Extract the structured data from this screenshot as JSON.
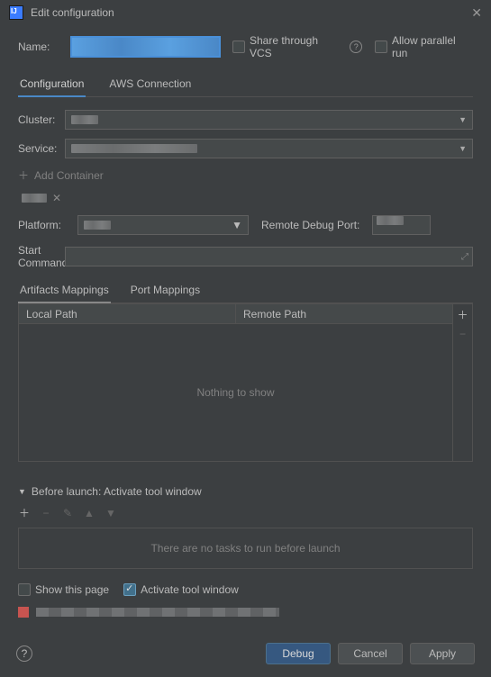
{
  "window": {
    "title": "Edit configuration"
  },
  "name": {
    "label": "Name:",
    "value": ""
  },
  "share_vcs": {
    "label": "Share through VCS",
    "checked": false
  },
  "allow_parallel": {
    "label": "Allow parallel run",
    "checked": false
  },
  "tabs": {
    "config": "Configuration",
    "aws": "AWS Connection"
  },
  "cluster": {
    "label": "Cluster:",
    "value": ""
  },
  "service": {
    "label": "Service:",
    "value": ""
  },
  "add_container": "Add Container",
  "container_tab": {
    "label": ""
  },
  "platform": {
    "label": "Platform:",
    "value": ""
  },
  "remote_port": {
    "label": "Remote Debug Port:",
    "value": ""
  },
  "start_cmd": {
    "label": "Start Command:",
    "value": ""
  },
  "subtabs": {
    "artifacts": "Artifacts Mappings",
    "ports": "Port Mappings"
  },
  "table": {
    "local": "Local Path",
    "remote": "Remote Path",
    "empty": "Nothing to show"
  },
  "before_launch": {
    "header": "Before launch: Activate tool window",
    "empty": "There are no tasks to run before launch"
  },
  "checks": {
    "show_page": "Show this page",
    "activate_window": "Activate tool window"
  },
  "error_text": "",
  "buttons": {
    "debug": "Debug",
    "cancel": "Cancel",
    "apply": "Apply"
  }
}
